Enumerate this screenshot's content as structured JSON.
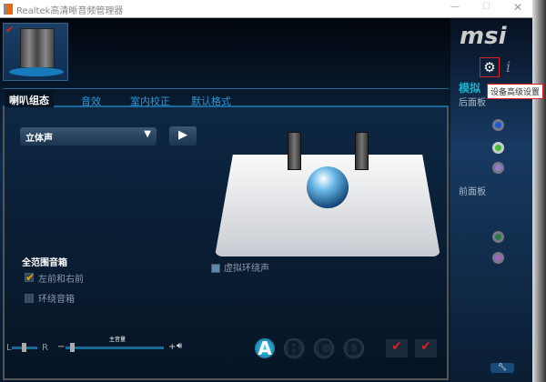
{
  "window": {
    "title": "Realtek高清晰音频管理器"
  },
  "tabs": [
    "喇叭组态",
    "音效",
    "室内校正",
    "默认格式"
  ],
  "config": {
    "selected": "立体声"
  },
  "fullrange": {
    "title": "全范围音箱",
    "items": [
      {
        "label": "左前和右前",
        "checked": true
      },
      {
        "label": "环绕音箱",
        "checked": false
      }
    ]
  },
  "virtual_surround": {
    "label": "虚拟环绕声",
    "checked": false
  },
  "volume": {
    "balance_left": "L",
    "balance_right": "R",
    "main_label": "主音量",
    "minus": "−",
    "plus": "+",
    "level": 0.05,
    "balance": 0.5
  },
  "profiles": [
    "A",
    "B",
    "C",
    "D"
  ],
  "sidebar": {
    "logo": "msi",
    "tooltip": "设备高级设置",
    "analog": "模拟",
    "rear": "后面板",
    "front": "前面板"
  },
  "colors": {
    "accent": "#2a9ad8",
    "tooltip_border": "#e02020"
  }
}
